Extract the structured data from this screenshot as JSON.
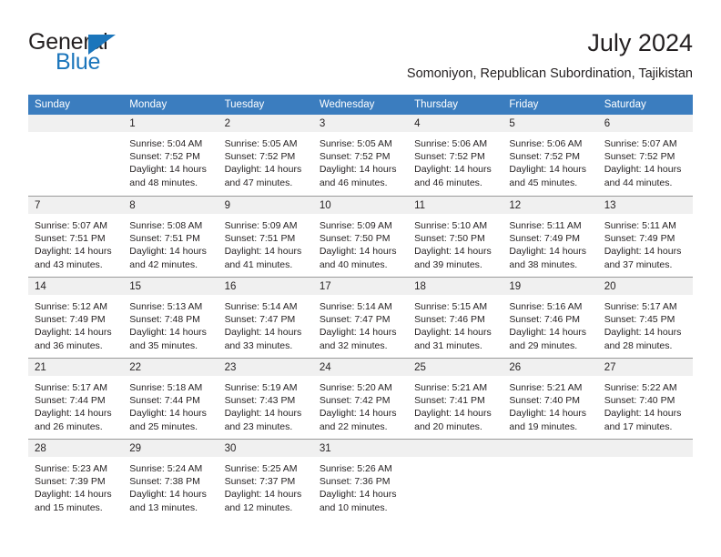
{
  "brand": {
    "name_part1": "General",
    "name_part2": "Blue",
    "triangle_color": "#1b75bb",
    "text_color": "#231f20"
  },
  "header": {
    "title": "July 2024",
    "subtitle": "Somoniyon, Republican Subordination, Tajikistan"
  },
  "theme": {
    "header_row_bg": "#3b7dbf",
    "header_row_text": "#ffffff",
    "daynum_band_bg": "#f0f0f0",
    "cell_bg": "#ffffff",
    "grid_line": "#9a9a9a",
    "body_text": "#231f20"
  },
  "weekday_headers": [
    "Sunday",
    "Monday",
    "Tuesday",
    "Wednesday",
    "Thursday",
    "Friday",
    "Saturday"
  ],
  "weeks": [
    [
      {
        "day": "",
        "empty": true,
        "sunrise": "",
        "sunset": "",
        "daylight_line1": "",
        "daylight_line2": ""
      },
      {
        "day": "1",
        "sunrise": "Sunrise: 5:04 AM",
        "sunset": "Sunset: 7:52 PM",
        "daylight_line1": "Daylight: 14 hours",
        "daylight_line2": "and 48 minutes."
      },
      {
        "day": "2",
        "sunrise": "Sunrise: 5:05 AM",
        "sunset": "Sunset: 7:52 PM",
        "daylight_line1": "Daylight: 14 hours",
        "daylight_line2": "and 47 minutes."
      },
      {
        "day": "3",
        "sunrise": "Sunrise: 5:05 AM",
        "sunset": "Sunset: 7:52 PM",
        "daylight_line1": "Daylight: 14 hours",
        "daylight_line2": "and 46 minutes."
      },
      {
        "day": "4",
        "sunrise": "Sunrise: 5:06 AM",
        "sunset": "Sunset: 7:52 PM",
        "daylight_line1": "Daylight: 14 hours",
        "daylight_line2": "and 46 minutes."
      },
      {
        "day": "5",
        "sunrise": "Sunrise: 5:06 AM",
        "sunset": "Sunset: 7:52 PM",
        "daylight_line1": "Daylight: 14 hours",
        "daylight_line2": "and 45 minutes."
      },
      {
        "day": "6",
        "sunrise": "Sunrise: 5:07 AM",
        "sunset": "Sunset: 7:52 PM",
        "daylight_line1": "Daylight: 14 hours",
        "daylight_line2": "and 44 minutes."
      }
    ],
    [
      {
        "day": "7",
        "sunrise": "Sunrise: 5:07 AM",
        "sunset": "Sunset: 7:51 PM",
        "daylight_line1": "Daylight: 14 hours",
        "daylight_line2": "and 43 minutes."
      },
      {
        "day": "8",
        "sunrise": "Sunrise: 5:08 AM",
        "sunset": "Sunset: 7:51 PM",
        "daylight_line1": "Daylight: 14 hours",
        "daylight_line2": "and 42 minutes."
      },
      {
        "day": "9",
        "sunrise": "Sunrise: 5:09 AM",
        "sunset": "Sunset: 7:51 PM",
        "daylight_line1": "Daylight: 14 hours",
        "daylight_line2": "and 41 minutes."
      },
      {
        "day": "10",
        "sunrise": "Sunrise: 5:09 AM",
        "sunset": "Sunset: 7:50 PM",
        "daylight_line1": "Daylight: 14 hours",
        "daylight_line2": "and 40 minutes."
      },
      {
        "day": "11",
        "sunrise": "Sunrise: 5:10 AM",
        "sunset": "Sunset: 7:50 PM",
        "daylight_line1": "Daylight: 14 hours",
        "daylight_line2": "and 39 minutes."
      },
      {
        "day": "12",
        "sunrise": "Sunrise: 5:11 AM",
        "sunset": "Sunset: 7:49 PM",
        "daylight_line1": "Daylight: 14 hours",
        "daylight_line2": "and 38 minutes."
      },
      {
        "day": "13",
        "sunrise": "Sunrise: 5:11 AM",
        "sunset": "Sunset: 7:49 PM",
        "daylight_line1": "Daylight: 14 hours",
        "daylight_line2": "and 37 minutes."
      }
    ],
    [
      {
        "day": "14",
        "sunrise": "Sunrise: 5:12 AM",
        "sunset": "Sunset: 7:49 PM",
        "daylight_line1": "Daylight: 14 hours",
        "daylight_line2": "and 36 minutes."
      },
      {
        "day": "15",
        "sunrise": "Sunrise: 5:13 AM",
        "sunset": "Sunset: 7:48 PM",
        "daylight_line1": "Daylight: 14 hours",
        "daylight_line2": "and 35 minutes."
      },
      {
        "day": "16",
        "sunrise": "Sunrise: 5:14 AM",
        "sunset": "Sunset: 7:47 PM",
        "daylight_line1": "Daylight: 14 hours",
        "daylight_line2": "and 33 minutes."
      },
      {
        "day": "17",
        "sunrise": "Sunrise: 5:14 AM",
        "sunset": "Sunset: 7:47 PM",
        "daylight_line1": "Daylight: 14 hours",
        "daylight_line2": "and 32 minutes."
      },
      {
        "day": "18",
        "sunrise": "Sunrise: 5:15 AM",
        "sunset": "Sunset: 7:46 PM",
        "daylight_line1": "Daylight: 14 hours",
        "daylight_line2": "and 31 minutes."
      },
      {
        "day": "19",
        "sunrise": "Sunrise: 5:16 AM",
        "sunset": "Sunset: 7:46 PM",
        "daylight_line1": "Daylight: 14 hours",
        "daylight_line2": "and 29 minutes."
      },
      {
        "day": "20",
        "sunrise": "Sunrise: 5:17 AM",
        "sunset": "Sunset: 7:45 PM",
        "daylight_line1": "Daylight: 14 hours",
        "daylight_line2": "and 28 minutes."
      }
    ],
    [
      {
        "day": "21",
        "sunrise": "Sunrise: 5:17 AM",
        "sunset": "Sunset: 7:44 PM",
        "daylight_line1": "Daylight: 14 hours",
        "daylight_line2": "and 26 minutes."
      },
      {
        "day": "22",
        "sunrise": "Sunrise: 5:18 AM",
        "sunset": "Sunset: 7:44 PM",
        "daylight_line1": "Daylight: 14 hours",
        "daylight_line2": "and 25 minutes."
      },
      {
        "day": "23",
        "sunrise": "Sunrise: 5:19 AM",
        "sunset": "Sunset: 7:43 PM",
        "daylight_line1": "Daylight: 14 hours",
        "daylight_line2": "and 23 minutes."
      },
      {
        "day": "24",
        "sunrise": "Sunrise: 5:20 AM",
        "sunset": "Sunset: 7:42 PM",
        "daylight_line1": "Daylight: 14 hours",
        "daylight_line2": "and 22 minutes."
      },
      {
        "day": "25",
        "sunrise": "Sunrise: 5:21 AM",
        "sunset": "Sunset: 7:41 PM",
        "daylight_line1": "Daylight: 14 hours",
        "daylight_line2": "and 20 minutes."
      },
      {
        "day": "26",
        "sunrise": "Sunrise: 5:21 AM",
        "sunset": "Sunset: 7:40 PM",
        "daylight_line1": "Daylight: 14 hours",
        "daylight_line2": "and 19 minutes."
      },
      {
        "day": "27",
        "sunrise": "Sunrise: 5:22 AM",
        "sunset": "Sunset: 7:40 PM",
        "daylight_line1": "Daylight: 14 hours",
        "daylight_line2": "and 17 minutes."
      }
    ],
    [
      {
        "day": "28",
        "sunrise": "Sunrise: 5:23 AM",
        "sunset": "Sunset: 7:39 PM",
        "daylight_line1": "Daylight: 14 hours",
        "daylight_line2": "and 15 minutes."
      },
      {
        "day": "29",
        "sunrise": "Sunrise: 5:24 AM",
        "sunset": "Sunset: 7:38 PM",
        "daylight_line1": "Daylight: 14 hours",
        "daylight_line2": "and 13 minutes."
      },
      {
        "day": "30",
        "sunrise": "Sunrise: 5:25 AM",
        "sunset": "Sunset: 7:37 PM",
        "daylight_line1": "Daylight: 14 hours",
        "daylight_line2": "and 12 minutes."
      },
      {
        "day": "31",
        "sunrise": "Sunrise: 5:26 AM",
        "sunset": "Sunset: 7:36 PM",
        "daylight_line1": "Daylight: 14 hours",
        "daylight_line2": "and 10 minutes."
      },
      {
        "day": "",
        "empty": true,
        "sunrise": "",
        "sunset": "",
        "daylight_line1": "",
        "daylight_line2": ""
      },
      {
        "day": "",
        "empty": true,
        "sunrise": "",
        "sunset": "",
        "daylight_line1": "",
        "daylight_line2": ""
      },
      {
        "day": "",
        "empty": true,
        "sunrise": "",
        "sunset": "",
        "daylight_line1": "",
        "daylight_line2": ""
      }
    ]
  ]
}
